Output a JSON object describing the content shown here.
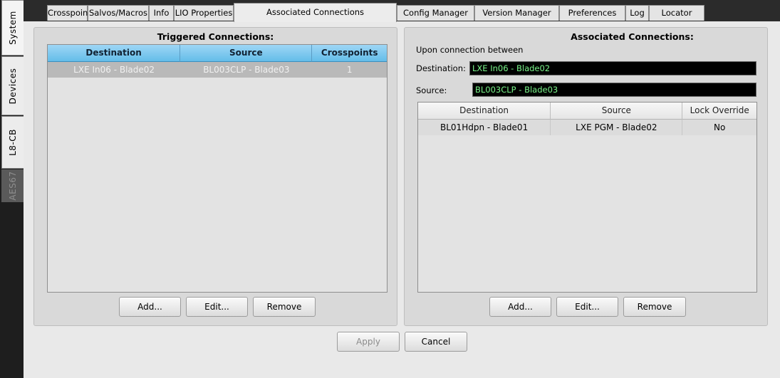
{
  "side_tabs": [
    {
      "label": "System"
    },
    {
      "label": "Devices"
    },
    {
      "label": "L8-CB"
    },
    {
      "label": "AES67"
    }
  ],
  "tabs": [
    {
      "label": "Crosspoint"
    },
    {
      "label": "Salvos/Macros"
    },
    {
      "label": "Info"
    },
    {
      "label": "LIO Properties"
    },
    {
      "label": "Associated Connections"
    },
    {
      "label": "Config Manager"
    },
    {
      "label": "Version Manager"
    },
    {
      "label": "Preferences"
    },
    {
      "label": "Log"
    },
    {
      "label": "Locator"
    }
  ],
  "triggered": {
    "title": "Triggered Connections:",
    "columns": [
      "Destination",
      "Source",
      "Crosspoints"
    ],
    "rows": [
      {
        "destination": "LXE In06 - Blade02",
        "source": "BL003CLP - Blade03",
        "crosspoints": "1"
      }
    ],
    "buttons": {
      "add": "Add...",
      "edit": "Edit...",
      "remove": "Remove"
    }
  },
  "associated": {
    "title": "Associated Connections:",
    "subtitle": "Upon connection between",
    "destination_label": "Destination:",
    "destination_value": "LXE In06 - Blade02",
    "source_label": "Source:",
    "source_value": "BL003CLP - Blade03",
    "columns": [
      "Destination",
      "Source",
      "Lock Override"
    ],
    "rows": [
      {
        "destination": "BL01Hdpn - Blade01",
        "source": "LXE PGM - Blade02",
        "lock_override": "No"
      }
    ],
    "buttons": {
      "add": "Add...",
      "edit": "Edit...",
      "remove": "Remove"
    }
  },
  "footer": {
    "apply": "Apply",
    "cancel": "Cancel"
  },
  "colors": {
    "header_blue": "#64bde9",
    "field_bg": "#000000",
    "field_text": "#7af58a"
  }
}
